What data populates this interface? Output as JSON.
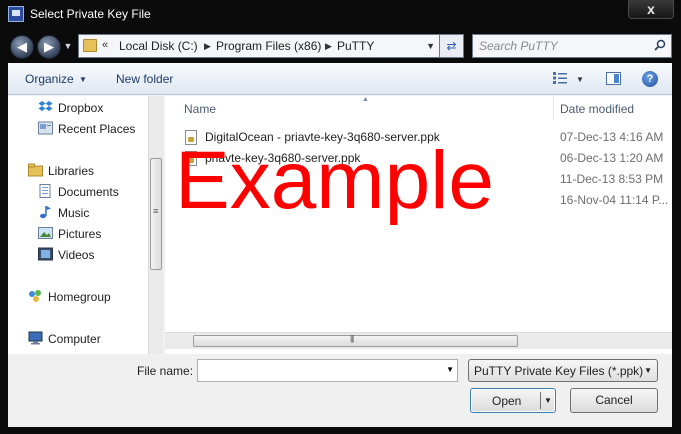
{
  "window": {
    "title": "Select Private Key File",
    "close_glyph": "x"
  },
  "address_bar": {
    "overflow": "«",
    "crumbs": [
      "Local Disk (C:)",
      "Program Files (x86)",
      "PuTTY"
    ]
  },
  "search": {
    "placeholder": "Search PuTTY"
  },
  "toolbar": {
    "organize_label": "Organize",
    "new_folder_label": "New folder",
    "help_glyph": "?"
  },
  "nav": {
    "items": [
      {
        "label": "Dropbox",
        "icon": "dropbox-icon"
      },
      {
        "label": "Recent Places",
        "icon": "recent-places-icon"
      },
      {
        "label": "Libraries",
        "icon": "libraries-icon"
      },
      {
        "label": "Documents",
        "icon": "documents-icon"
      },
      {
        "label": "Music",
        "icon": "music-icon"
      },
      {
        "label": "Pictures",
        "icon": "pictures-icon"
      },
      {
        "label": "Videos",
        "icon": "videos-icon"
      },
      {
        "label": "Homegroup",
        "icon": "homegroup-icon"
      },
      {
        "label": "Computer",
        "icon": "computer-icon"
      }
    ]
  },
  "files": {
    "columns": {
      "name": "Name",
      "date": "Date modified"
    },
    "rows": [
      {
        "name": "DigitalOcean - priavte-key-3q680-server.ppk",
        "date": "07-Dec-13 4:16 AM"
      },
      {
        "name": "priavte-key-3q680-server.ppk",
        "date": "06-Dec-13 1:20 AM"
      },
      {
        "name": "",
        "date": "11-Dec-13 8:53 PM"
      },
      {
        "name": "",
        "date": "16-Nov-04 11:14 P..."
      }
    ]
  },
  "watermark": "Example",
  "bottom": {
    "file_name_label": "File name:",
    "file_name_value": "",
    "file_type": "PuTTY Private Key Files (*.ppk)",
    "open_label": "Open",
    "cancel_label": "Cancel"
  },
  "colors": {
    "watermark": "#ff0000",
    "title_bar": "#0b0b0b",
    "toolbar": "#dfe7f1"
  }
}
